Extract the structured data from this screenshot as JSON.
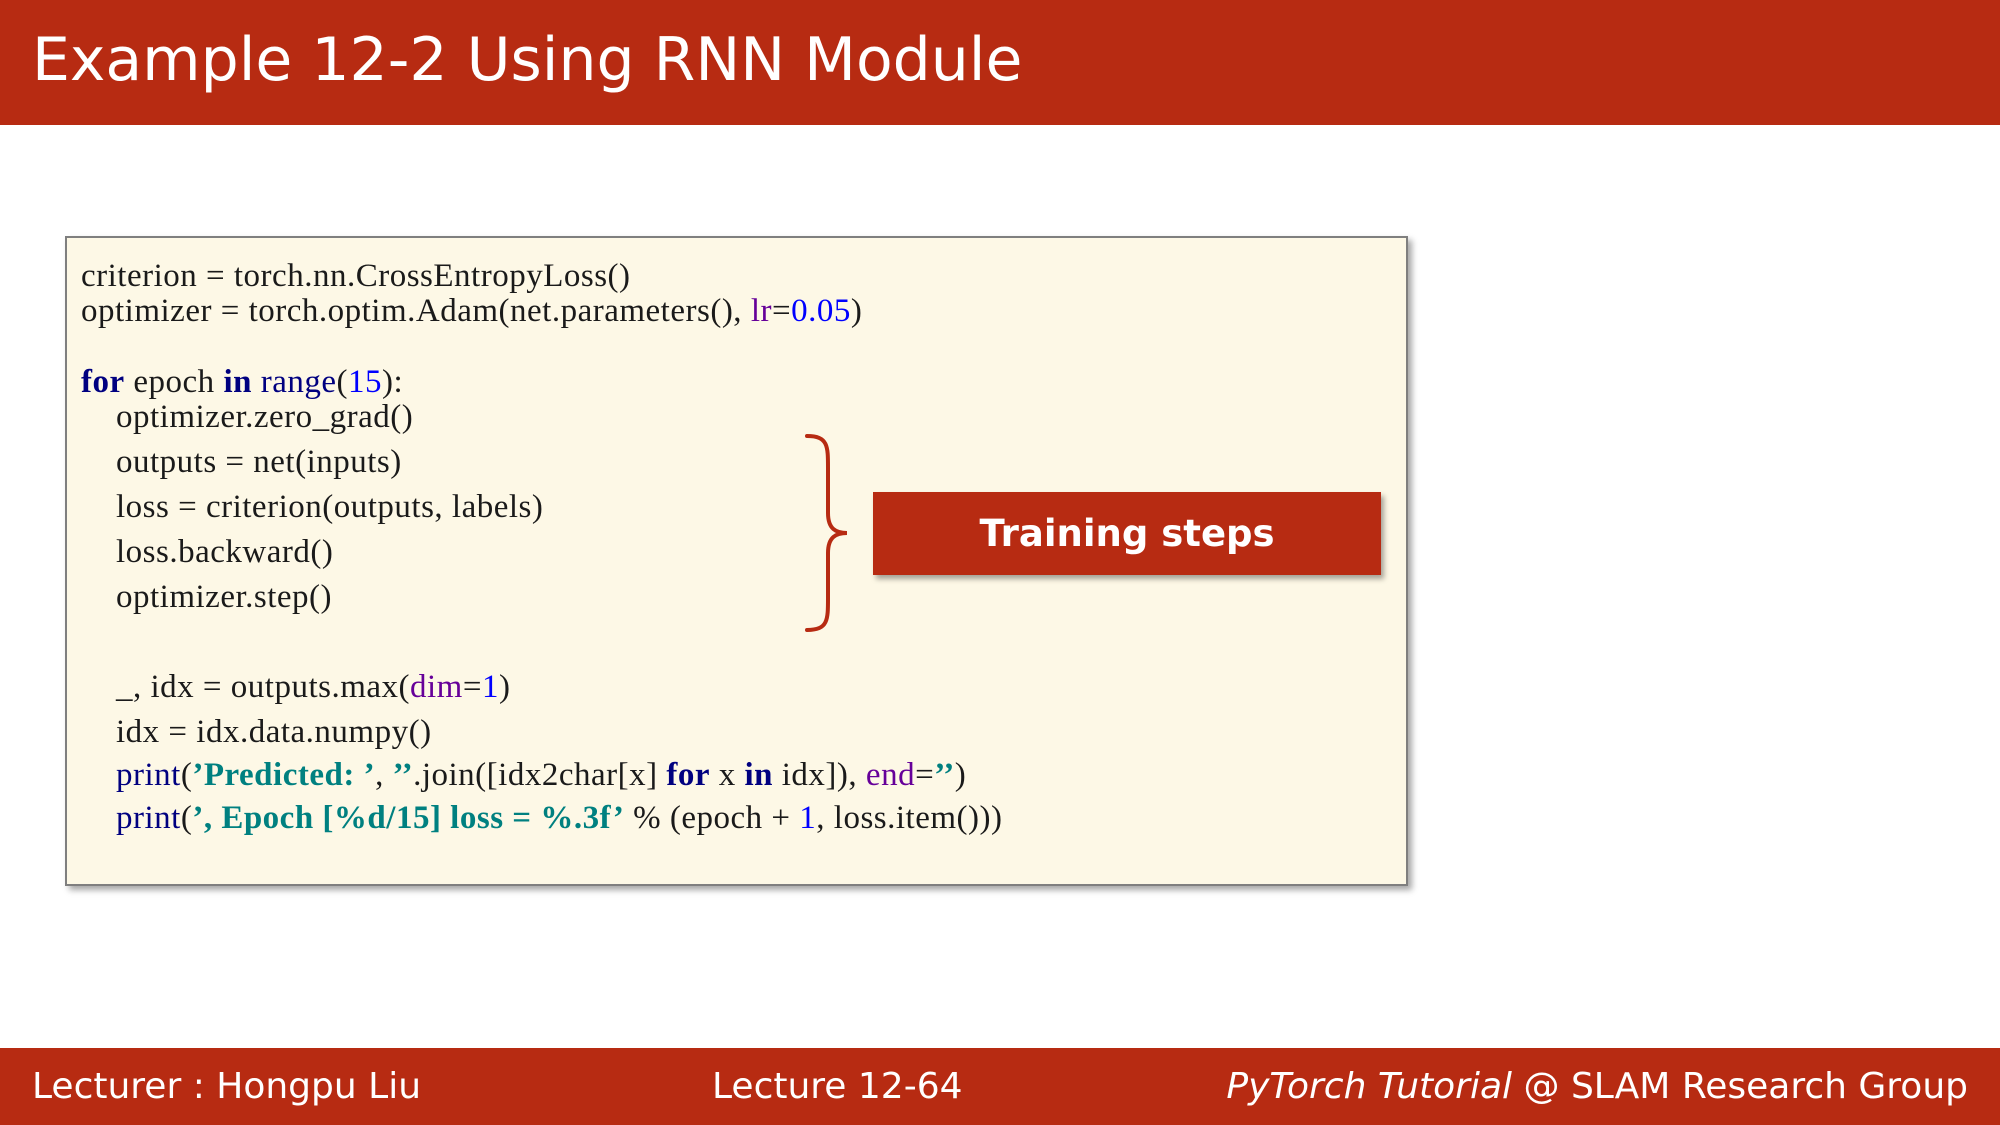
{
  "slide": {
    "title": "Example 12-2 Using RNN Module"
  },
  "code": {
    "line1": {
      "a": "criterion = torch.nn.CrossEntropyLoss()"
    },
    "line2": {
      "a": "optimizer = torch.optim.Adam(net.parameters(), ",
      "kwarg": "lr",
      "eq": "=",
      "num": "0.05",
      "end": ")"
    },
    "line3": {
      "kw1": "for",
      "a": " epoch ",
      "kw2": "in",
      "sp": " ",
      "bi": "range",
      "p1": "(",
      "num": "15",
      "p2": "):"
    },
    "line4": {
      "a": "    optimizer.zero_grad()"
    },
    "line5": {
      "a": "    outputs = net(inputs)"
    },
    "line6": {
      "a": "    loss = criterion(outputs, labels)"
    },
    "line7": {
      "a": "    loss.backward()"
    },
    "line8": {
      "a": "    optimizer.step()"
    },
    "line9": {
      "a": "    _, idx = outputs.max(",
      "kwarg": "dim",
      "eq": "=",
      "num": "1",
      "end": ")"
    },
    "line10": {
      "a": "    idx = idx.data.numpy()"
    },
    "line11": {
      "ind": "    ",
      "bi": "print",
      "p1": "(",
      "str": "’Predicted: ’",
      "b": ", ",
      "str2": "’’",
      "c": ".join([idx2char[x] ",
      "kw1": "for",
      "d": " x ",
      "kw2": "in",
      "e": " idx]), ",
      "kwarg": "end",
      "eq": "=",
      "str3": "’’",
      "end": ")"
    },
    "line12": {
      "ind": "    ",
      "bi": "print",
      "p1": "(",
      "str": "’, Epoch [%d/15] loss = %.3f’",
      "b": " % (epoch + ",
      "num": "1",
      "c": ", loss.item()))"
    }
  },
  "callout": {
    "label": "Training steps"
  },
  "footer": {
    "lecturer": "Lecturer : Hongpu Liu",
    "lecture": "Lecture 12-64",
    "course": "PyTorch Tutorial",
    "group": " @ SLAM Research Group"
  },
  "colors": {
    "brand_red": "#b72b12",
    "code_background": "#fdf8e6",
    "keyword": "#000080",
    "number": "#0000ff",
    "string": "#008080",
    "keyword_argument": "#660099"
  }
}
